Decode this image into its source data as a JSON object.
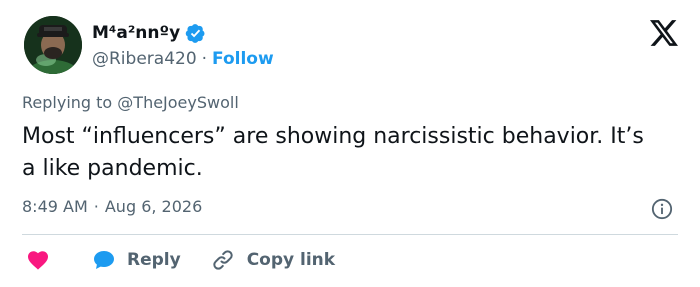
{
  "author": {
    "display_name": "M⁴a²nnºy",
    "handle": "@Ribera420",
    "separator": "·",
    "follow_label": "Follow",
    "avatar_icon": "profile-photo",
    "verified_icon": "verified-badge-icon",
    "verified_color": "#1d9bf0"
  },
  "tweet": {
    "replying_to": "Replying to @TheJoeySwoll",
    "text": "Most “influencers” are showing narcissistic behavior. It’s a like pandemic.",
    "time": "8:49 AM",
    "separator": "·",
    "date": "Aug 6, 2026"
  },
  "actions": {
    "like_icon": "heart-icon",
    "like_color": "#f91880",
    "reply_icon": "speech-bubble-icon",
    "reply_color": "#1d9bf0",
    "reply_label": "Reply",
    "copy_icon": "link-icon",
    "copy_label": "Copy link"
  },
  "brand": {
    "logo_icon": "x-logo-icon",
    "info_icon": "info-icon"
  },
  "colors": {
    "text_primary": "#0f1419",
    "text_secondary": "#536471",
    "accent": "#1d9bf0",
    "divider": "#cfd9de"
  }
}
